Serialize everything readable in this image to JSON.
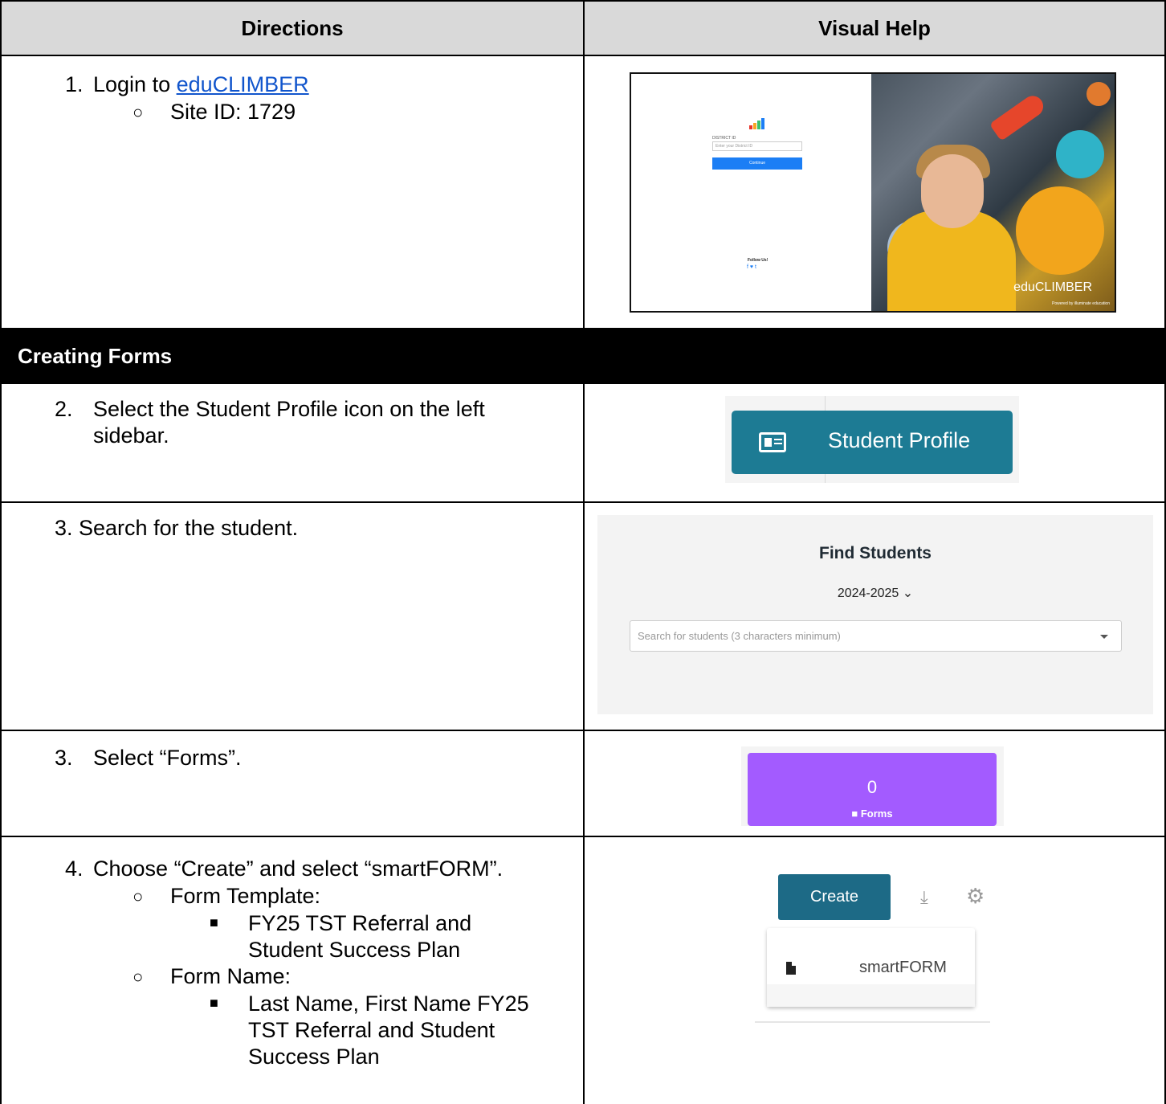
{
  "table": {
    "headers": {
      "directions": "Directions",
      "visual_help": "Visual Help"
    },
    "section_title": "Creating Forms"
  },
  "steps": {
    "s1": {
      "num": "1.",
      "text": "Login to ",
      "link": "eduCLIMBER",
      "bullet": "○",
      "sub": "Site ID:  1729"
    },
    "s2": {
      "num": "2.",
      "line1": "Select the Student Profile icon on the left",
      "line2": "sidebar."
    },
    "s3": {
      "text": "3.  Search for the student."
    },
    "s3b": {
      "num": "3.",
      "text": "Select “Forms”."
    },
    "s4": {
      "num": "4.",
      "text": "Choose “Create” and select “smartFORM”.",
      "bullet": "○",
      "square": "■",
      "template_label": "Form Template:",
      "template_l1": "FY25 TST Referral and",
      "template_l2": "Student Success Plan",
      "name_label": "Form Name:",
      "name_l1": "Last Name, First Name FY25",
      "name_l2": "TST Referral and Student",
      "name_l3": "Success Plan"
    }
  },
  "visuals": {
    "login": {
      "district_label": "DISTRICT ID",
      "placeholder": "Enter your District ID",
      "continue": "Continue",
      "follow": "Follow Us!",
      "social": "f ♥ t",
      "brand": "eduCLIMBER",
      "powered": "Powered by illuminate education",
      "logo_colors": [
        "#e8342b",
        "#f5a623",
        "#3ac16d",
        "#1b7ef5"
      ]
    },
    "student_profile": {
      "label": "Student Profile"
    },
    "find_students": {
      "title": "Find Students",
      "year": "2024-2025 ⌄",
      "placeholder": "Search for students (3 characters minimum)"
    },
    "forms_tile": {
      "count": "0",
      "label": "■ Forms"
    },
    "create": {
      "button": "Create",
      "download": "⤓",
      "gear": "⚙",
      "menu_item": "smartFORM"
    }
  }
}
